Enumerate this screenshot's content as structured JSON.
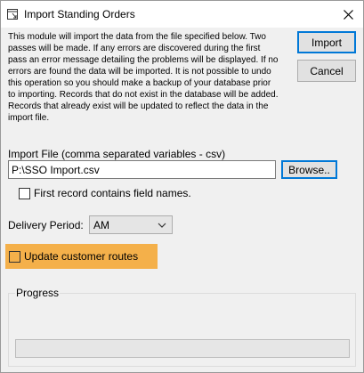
{
  "window": {
    "title": "Import Standing Orders",
    "close_symbol": "✕"
  },
  "info_text": "This module will import the data from the file specified below. Two passes will be made. If any errors are discovered during the first pass an error message detailing the problems will be displayed. If no errors are found the data will be imported. It is not possible to undo this operation so you should make a backup of your database prior to importing. Records that do not exist in the database will be added. Records that already exist will be updated to reflect the data in the import file.",
  "buttons": {
    "import": "Import",
    "cancel": "Cancel",
    "browse": "Browse.."
  },
  "import_file": {
    "label": "Import File (comma separated variables - csv)",
    "value": "P:\\SSO Import.csv"
  },
  "first_record_checkbox": {
    "label": "First record contains field names.",
    "checked": false
  },
  "delivery_period": {
    "label": "Delivery Period:",
    "selected": "AM"
  },
  "update_routes_checkbox": {
    "label": "Update customer routes",
    "checked": false,
    "highlight_color": "#f4b04a"
  },
  "progress": {
    "label": "Progress",
    "value": 0
  }
}
